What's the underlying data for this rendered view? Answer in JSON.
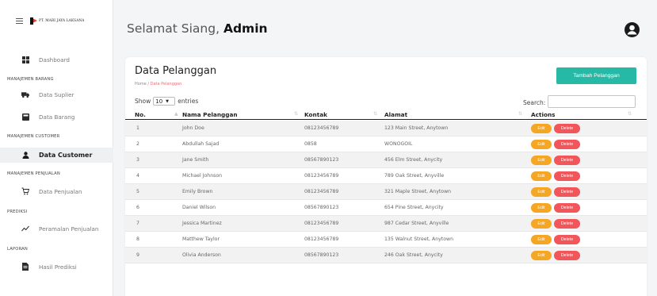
{
  "brand": {
    "logo_text": "PT. MARI JAYA LAKSANA"
  },
  "sidebar": {
    "items": [
      {
        "label": "Dashboard"
      },
      {
        "label": "Data Suplier"
      },
      {
        "label": "Data Barang"
      },
      {
        "label": "Data Customer"
      },
      {
        "label": "Data Penjualan"
      },
      {
        "label": "Peramalan Penjualan"
      },
      {
        "label": "Hasil Prediksi"
      }
    ],
    "sections": [
      "MANAJEMEN BARANG",
      "MANAJEMEN CUSTOMER",
      "MANAJEMEN PENJUALAN",
      "PREDIKSI",
      "LAPORAN"
    ]
  },
  "header": {
    "greeting": "Selamat Siang, ",
    "user": "Admin"
  },
  "card": {
    "title": "Data Pelanggan",
    "breadcrumb_home": "Home / ",
    "breadcrumb_current": "Data Pelanggan",
    "add_button": "Tambah Pelanggan",
    "show_label": "Show",
    "show_value": "10",
    "entries_label": "entries",
    "search_label": "Search:"
  },
  "table": {
    "headers": {
      "no": "No.",
      "name": "Nama Pelanggan",
      "contact": "Kontak",
      "address": "Alamat",
      "actions": "Actions"
    },
    "edit_label": "Edit",
    "delete_label": "Delete",
    "rows": [
      {
        "no": "1",
        "name": "John Doe",
        "contact": "08123456789",
        "address": "123 Main Street, Anytown"
      },
      {
        "no": "2",
        "name": "Abdullah Sajad",
        "contact": "0858",
        "address": "WONOGOIL"
      },
      {
        "no": "3",
        "name": "Jane Smith",
        "contact": "08567890123",
        "address": "456 Elm Street, Anycity"
      },
      {
        "no": "4",
        "name": "Michael Johnson",
        "contact": "08123456789",
        "address": "789 Oak Street, Anyville"
      },
      {
        "no": "5",
        "name": "Emily Brown",
        "contact": "08123456789",
        "address": "321 Maple Street, Anytown"
      },
      {
        "no": "6",
        "name": "Daniel Wilson",
        "contact": "08567890123",
        "address": "654 Pine Street, Anycity"
      },
      {
        "no": "7",
        "name": "Jessica Martinez",
        "contact": "08123456789",
        "address": "987 Cedar Street, Anyville"
      },
      {
        "no": "8",
        "name": "Matthew Taylor",
        "contact": "08123456789",
        "address": "135 Walnut Street, Anytown"
      },
      {
        "no": "9",
        "name": "Olivia Anderson",
        "contact": "08567890123",
        "address": "246 Oak Street, Anycity"
      }
    ]
  },
  "icons": {
    "menu": "hamburger-icon",
    "dashboard": "grid-icon",
    "supplier": "truck-icon",
    "barang": "box-icon",
    "customer": "user-icon",
    "penjualan": "cart-icon",
    "peramalan": "trend-icon",
    "prediksi": "document-icon",
    "avatar": "user-circle-icon"
  },
  "colors": {
    "accent": "#26b9a5",
    "edit": "#f5a623",
    "delete": "#f2555a",
    "breadcrumb_active": "#f06a75"
  }
}
